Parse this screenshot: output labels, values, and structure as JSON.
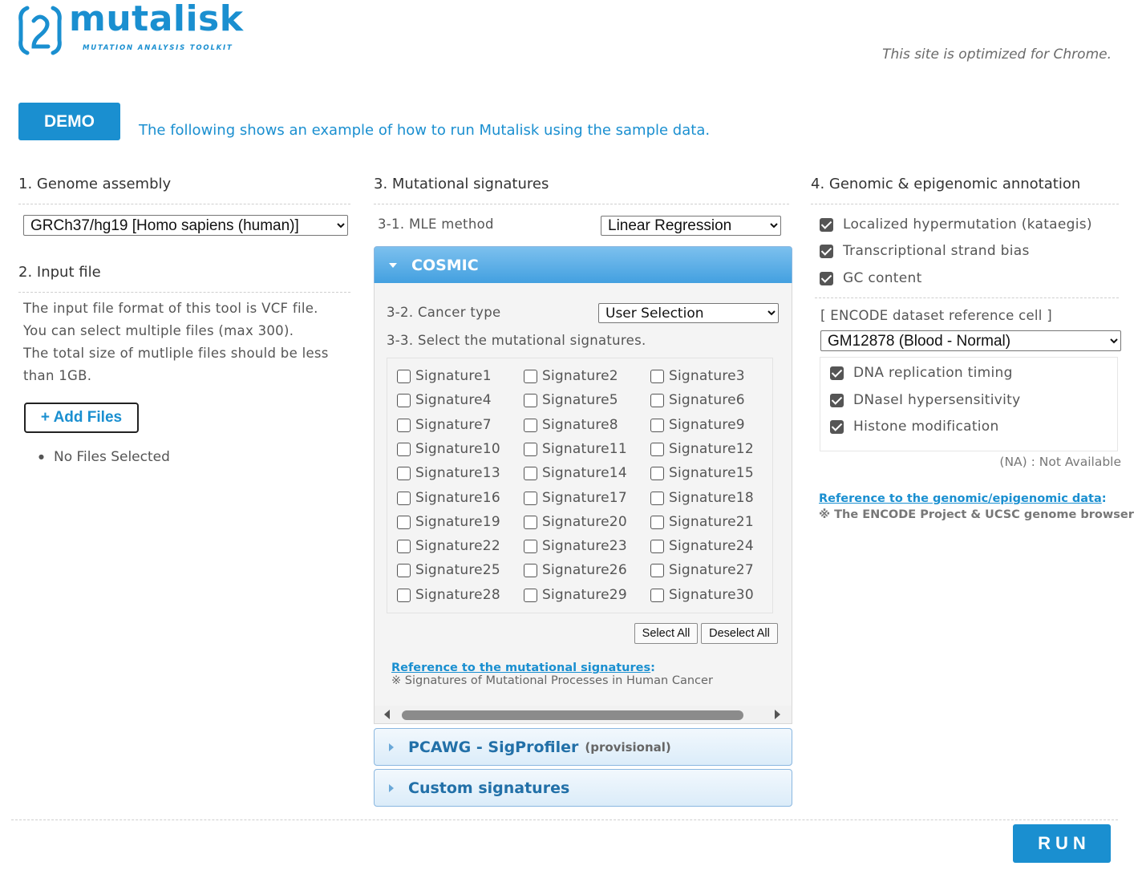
{
  "header": {
    "logo_name": "mutalisk",
    "logo_tagline": "MUTATION ANALYSIS TOOLKIT",
    "optimized_prefix": "This site is optimized for ",
    "optimized_browser": "Chrome",
    "optimized_suffix": "."
  },
  "demo": {
    "button_label": "DEMO",
    "description": "The following shows an example of how to run Mutalisk using the sample data."
  },
  "genome": {
    "title": "1. Genome assembly",
    "selected": "GRCh37/hg19 [Homo sapiens (human)]"
  },
  "input_file": {
    "title": "2. Input file",
    "lines": [
      "The input file format of this tool is VCF file.",
      "You can select multiple files (max 300).",
      "The total size of mutliple files should be less",
      "than 1GB."
    ],
    "add_files_label": "+ Add Files",
    "no_files": "No Files Selected"
  },
  "signatures": {
    "title": "3. Mutational signatures",
    "mle_label": "3-1. MLE method",
    "mle_selected": "Linear Regression",
    "cosmic": {
      "label": "COSMIC",
      "cancer_label": "3-2. Cancer type",
      "cancer_selected": "User Selection",
      "select_label": "3-3. Select the mutational signatures.",
      "items": [
        "Signature1",
        "Signature2",
        "Signature3",
        "Signature4",
        "Signature5",
        "Signature6",
        "Signature7",
        "Signature8",
        "Signature9",
        "Signature10",
        "Signature11",
        "Signature12",
        "Signature13",
        "Signature14",
        "Signature15",
        "Signature16",
        "Signature17",
        "Signature18",
        "Signature19",
        "Signature20",
        "Signature21",
        "Signature22",
        "Signature23",
        "Signature24",
        "Signature25",
        "Signature26",
        "Signature27",
        "Signature28",
        "Signature29",
        "Signature30"
      ],
      "select_all": "Select All",
      "deselect_all": "Deselect All",
      "ref_link": "Reference to the mutational signatures",
      "ref_colon": ":",
      "ref_note": "※ Signatures of Mutational Processes in Human Cancer"
    },
    "pcawg": {
      "label": "PCAWG - SigProfiler",
      "sub": "(provisional)"
    },
    "custom": {
      "label": "Custom signatures"
    }
  },
  "annotation": {
    "title": "4. Genomic & epigenomic annotation",
    "options": [
      {
        "label": "Localized hypermutation (kataegis)",
        "checked": true
      },
      {
        "label": "Transcriptional strand bias",
        "checked": true
      },
      {
        "label": "GC content",
        "checked": true
      }
    ],
    "encode_label": "[ ENCODE dataset reference cell ]",
    "encode_selected": "GM12878 (Blood - Normal)",
    "encode_options": [
      {
        "label": "DNA replication timing",
        "checked": true
      },
      {
        "label": "DNaseI hypersensitivity",
        "checked": true
      },
      {
        "label": "Histone modification",
        "checked": true
      }
    ],
    "na_note": "(NA) : Not Available",
    "ref_link": "Reference to the genomic/epigenomic data",
    "ref_colon": ":",
    "ref_note": "※ The ENCODE Project & UCSC genome browser"
  },
  "run_label": "RUN",
  "colors": {
    "accent": "#1a8fd0",
    "text": "#555555"
  }
}
